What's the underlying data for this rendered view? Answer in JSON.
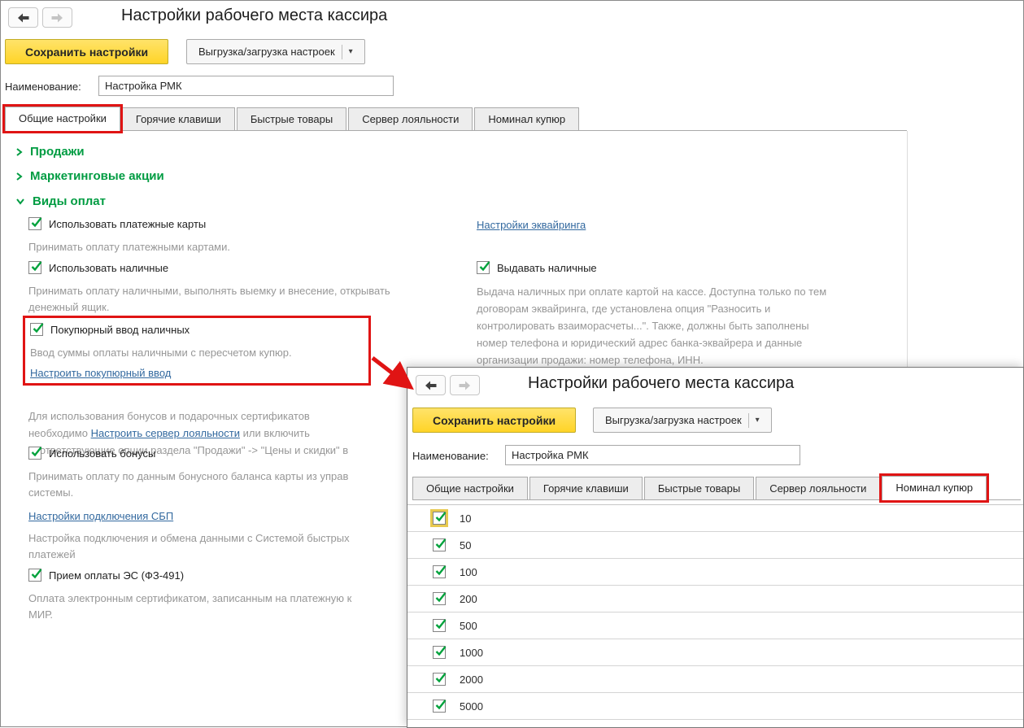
{
  "colors": {
    "accent_yellow": "#FFD427",
    "green": "#009C42",
    "link_blue": "#33699F",
    "annotation_red": "#E01414",
    "muted_gray": "#979797"
  },
  "main_window": {
    "title": "Настройки рабочего места кассира",
    "toolbar": {
      "save": "Сохранить настройки",
      "export": "Выгрузка/загрузка настроек"
    },
    "name_field": {
      "label": "Наименование:",
      "value": "Настройка РМК"
    },
    "tabs": [
      "Общие настройки",
      "Горячие клавиши",
      "Быстрые товары",
      "Сервер лояльности",
      "Номинал купюр"
    ],
    "active_tab": "Общие настройки",
    "sections": {
      "sales": "Продажи",
      "marketing": "Маркетинговые акции",
      "payments": "Виды оплат"
    },
    "options": {
      "cards": {
        "label": "Использовать платежные карты",
        "desc": "Принимать оплату платежными картами."
      },
      "cash": {
        "label": "Использовать наличные",
        "desc": "Принимать оплату наличными, выполнять выемку и внесение, открывать\nденежный ящик."
      },
      "bill_input": {
        "label": "Покупюрный ввод наличных",
        "desc": "Ввод суммы оплаты наличными с пересчетом купюр.",
        "link": "Настроить покупюрный ввод"
      },
      "bonus": {
        "label": "Использовать бонусы",
        "desc": "Принимать оплату по данным бонусного баланса карты из управ\nсистемы."
      },
      "es": {
        "label": "Прием оплаты ЭС (ФЗ-491)",
        "desc": "Оплата электронным сертификатом, записанным на платежную к\nМИР."
      },
      "cashout": {
        "label": "Выдавать наличные",
        "desc": "Выдача наличных при оплате картой на кассе. Доступна только по тем\nдоговорам эквайринга, где установлена опция \"Разносить и\nконтролировать взаиморасчеты...\". Также, должны быть заполнены\nномер телефона и юридический адрес банка-эквайрера и данные\nорганизации продажи: номер телефона, ИНН."
      }
    },
    "loyalty_note": {
      "before": "Для использования бонусов и подарочных сертификатов\nнеобходимо ",
      "link": "Настроить сервер лояльности",
      "after": " или включить\nсоответствующие опции раздела \"Продажи\" -> \"Цены и скидки\" в"
    },
    "links": {
      "acquiring": "Настройки эквайринга",
      "sbp": "Настройки подключения СБП"
    },
    "sbp_desc": "Настройка подключения и обмена данными с Системой быстрых\nплатежей"
  },
  "overlay_window": {
    "title": "Настройки рабочего места кассира",
    "toolbar": {
      "save": "Сохранить настройки",
      "export": "Выгрузка/загрузка настроек"
    },
    "name_field": {
      "label": "Наименование:",
      "value": "Настройка РМК"
    },
    "tabs": [
      "Общие настройки",
      "Горячие клавиши",
      "Быстрые товары",
      "Сервер лояльности",
      "Номинал купюр"
    ],
    "active_tab": "Номинал купюр",
    "denominations": [
      "10",
      "50",
      "100",
      "200",
      "500",
      "1000",
      "2000",
      "5000"
    ]
  }
}
